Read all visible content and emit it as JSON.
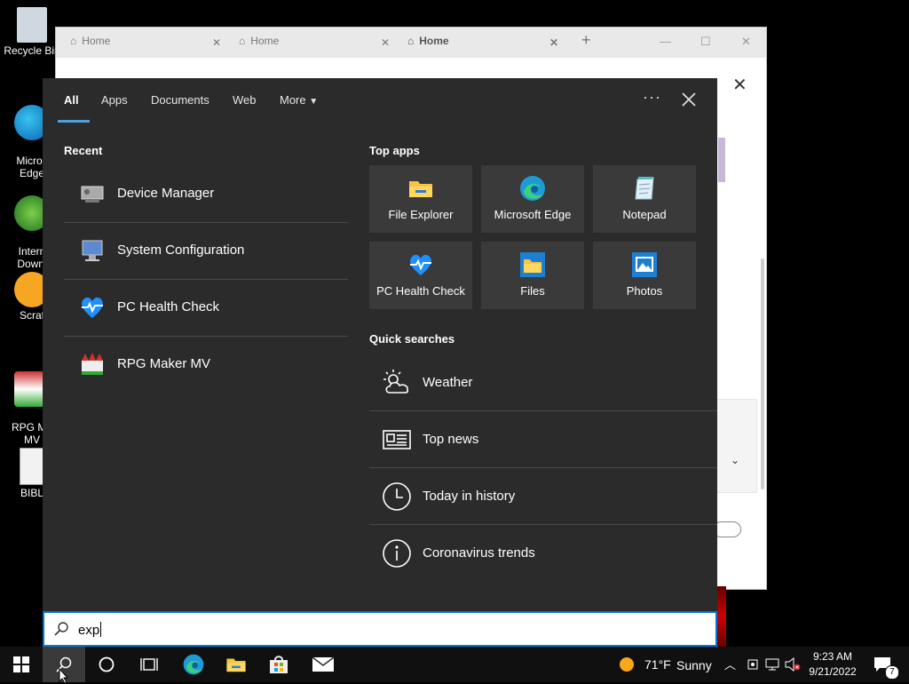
{
  "desktop": {
    "icons": [
      {
        "label": "Recycle Bin"
      },
      {
        "label": "Micros\nEdge"
      },
      {
        "label": "Intern\nDownl"
      },
      {
        "label": "Scrat"
      },
      {
        "label": "RPG Ma\nMV"
      },
      {
        "label": "BIBL"
      }
    ]
  },
  "browser": {
    "tabs": [
      {
        "label": "Home"
      },
      {
        "label": "Home"
      },
      {
        "label": "Home"
      }
    ],
    "new_tab": "+"
  },
  "search_panel": {
    "tabs": [
      "All",
      "Apps",
      "Documents",
      "Web",
      "More"
    ],
    "active_tab": "All",
    "more_icon": "ellipsis-icon",
    "recent": {
      "title": "Recent",
      "items": [
        {
          "label": "Device Manager",
          "icon": "device-manager-icon"
        },
        {
          "label": "System Configuration",
          "icon": "system-configuration-icon"
        },
        {
          "label": "PC Health Check",
          "icon": "pc-health-check-icon"
        },
        {
          "label": "RPG Maker MV",
          "icon": "rpg-maker-icon"
        }
      ]
    },
    "top_apps": {
      "title": "Top apps",
      "items": [
        {
          "label": "File Explorer",
          "icon": "file-explorer-icon"
        },
        {
          "label": "Microsoft Edge",
          "icon": "edge-icon"
        },
        {
          "label": "Notepad",
          "icon": "notepad-icon"
        },
        {
          "label": "PC Health Check",
          "icon": "pc-health-check-icon"
        },
        {
          "label": "Files",
          "icon": "files-icon"
        },
        {
          "label": "Photos",
          "icon": "photos-icon"
        }
      ]
    },
    "quick_searches": {
      "title": "Quick searches",
      "items": [
        {
          "label": "Weather",
          "icon": "weather-icon"
        },
        {
          "label": "Top news",
          "icon": "news-icon"
        },
        {
          "label": "Today in history",
          "icon": "clock-icon"
        },
        {
          "label": "Coronavirus trends",
          "icon": "info-icon"
        }
      ]
    },
    "search": {
      "value": "exp"
    }
  },
  "taskbar": {
    "weather_temp": "71°F",
    "weather_cond": "Sunny",
    "time": "9:23 AM",
    "date": "9/21/2022",
    "notification_count": "7"
  },
  "colors": {
    "accent": "#0078d4",
    "panel_bg": "#2b2b2b",
    "tile_bg": "#3a3a3a"
  }
}
